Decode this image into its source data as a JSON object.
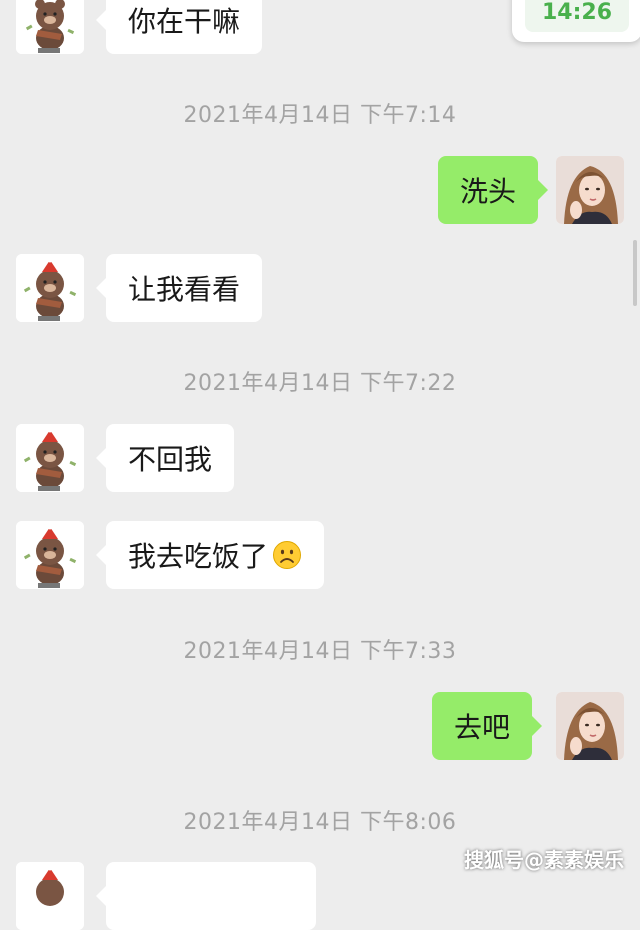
{
  "status_popup": {
    "time": "14:26"
  },
  "messages": [
    {
      "side": "in",
      "text": "你在干嘛"
    },
    {
      "timestamp": "2021年4月14日 下午7:14"
    },
    {
      "side": "out",
      "text": "洗头"
    },
    {
      "side": "in",
      "text": "让我看看"
    },
    {
      "timestamp": "2021年4月14日 下午7:22"
    },
    {
      "side": "in",
      "text": "不回我"
    },
    {
      "side": "in",
      "text": "我去吃饭了",
      "emoji": "frowning-face-icon"
    },
    {
      "timestamp": "2021年4月14日 下午7:33"
    },
    {
      "side": "out",
      "text": "去吧"
    },
    {
      "timestamp": "2021年4月14日 下午8:06"
    }
  ],
  "watermark": "搜狐号@素素娱乐",
  "colors": {
    "background": "#ededed",
    "incoming_bubble": "#ffffff",
    "outgoing_bubble": "#95ec69",
    "timestamp_text": "#a3a3a3"
  }
}
